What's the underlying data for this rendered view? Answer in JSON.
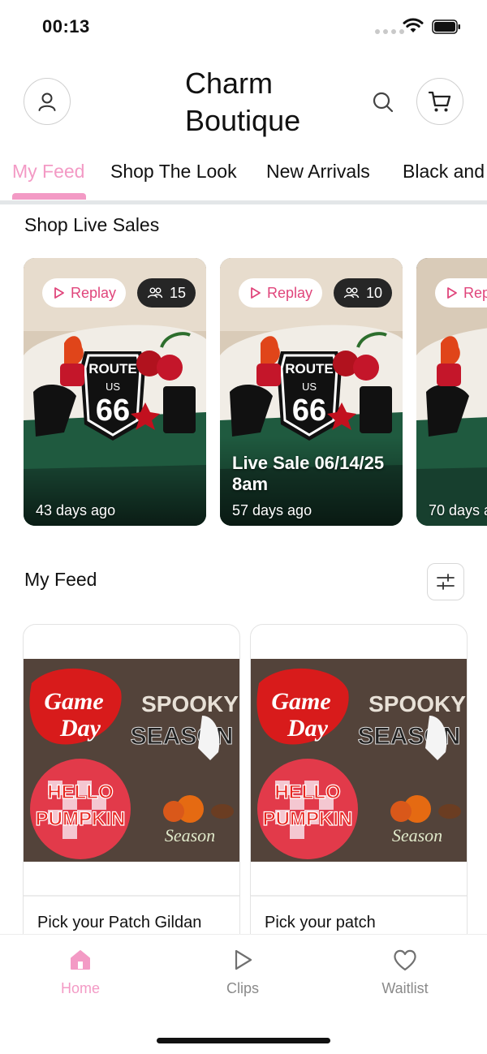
{
  "status_bar": {
    "time": "00:13"
  },
  "header": {
    "title": "Charm Boutique",
    "profile_icon": "person-icon",
    "search_icon": "search-icon",
    "cart_icon": "cart-icon"
  },
  "tabs": [
    {
      "label": "My Feed",
      "active": true
    },
    {
      "label": "Shop The Look",
      "active": false
    },
    {
      "label": "New Arrivals",
      "active": false
    },
    {
      "label": "Black and",
      "active": false
    }
  ],
  "live_sales": {
    "title": "Shop Live Sales",
    "cards": [
      {
        "replay": "Replay",
        "viewers": "15",
        "ago": "43 days ago",
        "live_text": ""
      },
      {
        "replay": "Replay",
        "viewers": "10",
        "ago": "57 days ago",
        "live_text": "Live Sale 06/14/25 8am"
      },
      {
        "replay": "Rep",
        "viewers": "",
        "ago": "70 days a",
        "live_text": ""
      }
    ]
  },
  "feed": {
    "title": "My Feed",
    "filter_icon": "sliders-icon",
    "items": [
      {
        "title": "Pick your Patch Gildan"
      },
      {
        "title": "Pick your patch"
      }
    ]
  },
  "bottom_nav": [
    {
      "label": "Home",
      "icon": "home-icon",
      "active": true
    },
    {
      "label": "Clips",
      "icon": "play-icon",
      "active": false
    },
    {
      "label": "Waitlist",
      "icon": "heart-icon",
      "active": false
    }
  ],
  "colors": {
    "accent": "#f39ac5",
    "replay_text": "#e0457b",
    "tab_underline": "#e3e6e8"
  }
}
